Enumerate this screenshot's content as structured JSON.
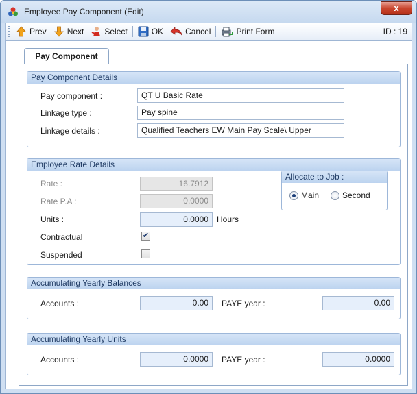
{
  "window": {
    "title": "Employee Pay Component (Edit)",
    "close_label": "x"
  },
  "toolbar": {
    "prev_label": "Prev",
    "next_label": "Next",
    "select_label": "Select",
    "ok_label": "OK",
    "cancel_label": "Cancel",
    "print_label": "Print Form",
    "id_text": "ID : 19"
  },
  "tabs": [
    {
      "label": "Pay Component"
    }
  ],
  "pay_component_details": {
    "header": "Pay Component Details",
    "pay_component_label": "Pay component :",
    "pay_component_value": "QT U Basic Rate",
    "linkage_type_label": "Linkage type :",
    "linkage_type_value": "Pay spine",
    "linkage_details_label": "Linkage details :",
    "linkage_details_value": "Qualified Teachers EW Main Pay Scale\\ Upper"
  },
  "employee_rate_details": {
    "header": "Employee Rate Details",
    "rate_label": "Rate :",
    "rate_value": "16.7912",
    "rate_pa_label": "Rate P.A :",
    "rate_pa_value": "0.0000",
    "units_label": "Units :",
    "units_value": "0.0000",
    "units_suffix": "Hours",
    "contractual_label": "Contractual",
    "contractual_checked": true,
    "contractual_mark": "✔",
    "suspended_label": "Suspended",
    "suspended_checked": false,
    "allocate": {
      "header": "Allocate to Job :",
      "options": [
        {
          "label": "Main",
          "selected": true
        },
        {
          "label": "Second",
          "selected": false
        }
      ]
    }
  },
  "yearly_balances": {
    "header": "Accumulating Yearly Balances",
    "accounts_label": "Accounts :",
    "accounts_value": "0.00",
    "paye_label": "PAYE year :",
    "paye_value": "0.00"
  },
  "yearly_units": {
    "header": "Accumulating Yearly Units",
    "accounts_label": "Accounts :",
    "accounts_value": "0.0000",
    "paye_label": "PAYE year :",
    "paye_value": "0.0000"
  },
  "colors": {
    "window_frame": "#cfdff2",
    "group_header": "#bcd3ef",
    "close_button": "#c9462f",
    "readonly_field": "#e6e6e6"
  }
}
